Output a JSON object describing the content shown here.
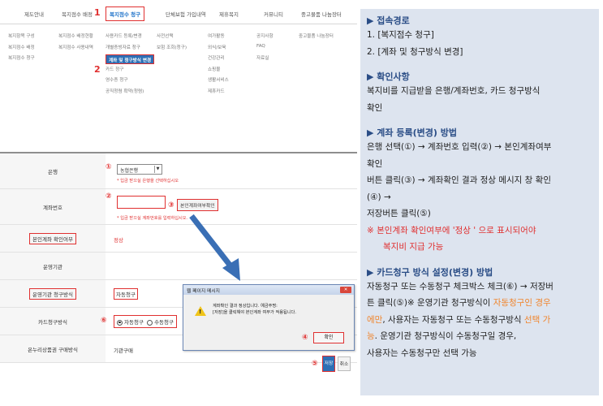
{
  "topnav": {
    "tabs": [
      "제도안내",
      "복지점수 배정",
      "복지점수 청구",
      "단체보험 가입내역",
      "제휴복지",
      "커뮤니티",
      "중고물품 나눔장터"
    ],
    "marker1": "1",
    "marker2": "2"
  },
  "submenu": {
    "col1": [
      "복지항목 구성",
      "복지점수 배정",
      "복지점수 청구"
    ],
    "col2": [
      "복지점수 배정현황",
      "복지점수 사용내역"
    ],
    "col3": [
      "사용카드 등록/변경",
      "개별증빙자료 청구",
      "계좌 및 청구방식 변경",
      "카드 청구",
      "영수증 청구",
      "공직청렴 확약(청렴)"
    ],
    "col4": [
      "사전선택",
      "보험 조회(청구)"
    ],
    "col5": [
      "여가활동",
      "외식/보육",
      "건강관리",
      "쇼핑몰",
      "생활서비스",
      "제휴카드"
    ],
    "col6": [
      "공지사항",
      "FAQ",
      "자료실"
    ],
    "col7": [
      "중고물품 나눔장터"
    ]
  },
  "form": {
    "bank_label": "은행",
    "bank_marker": "①",
    "bank_value": "농협은행",
    "bank_hint": "* 입금 받으실 은행을 선택하십시오",
    "account_label": "계좌번호",
    "account_marker": "②",
    "verify_marker": "③",
    "verify_button": "본인계좌여부확인",
    "account_hint": "* 입금 받으실 계좌번호를 입력하십시오.",
    "owner_check_label": "본인계좌 확인여부",
    "owner_check_value": "정상",
    "org_label": "운영기관",
    "org_method_label": "운영기관 청구방식",
    "org_method_value": "자동청구",
    "card_method_label": "카드청구방식",
    "card_marker": "⑥",
    "card_auto": "자동청구",
    "card_manual": "수동청구",
    "online_label": "온누리상품권 구매방식",
    "online_value": "기관구매",
    "save_marker": "⑤",
    "save_button": "저장",
    "cancel_button": "취소"
  },
  "dialog": {
    "title": "웹 페이지 메시지",
    "close": "✕",
    "message_line1": "계좌확인 결과 정상입니다. 예금주명:",
    "message_line2": "[저장]을 클릭해야 본인계좌 여부가 적용됩니다.",
    "ok_marker": "④",
    "ok_button": "확인"
  },
  "panel": {
    "s1_title": "▶ 접속경로",
    "s1_line1": "1. [복지점수 청구]",
    "s1_line2": "2. [계좌 및 청구방식 변경]",
    "s2_title": "▶ 확인사항",
    "s2_line1": "복지비를 지급받을 은행/계좌번호, 카드 청구방식",
    "s2_line2": "확인",
    "s3_title": "▶ 계좌 등록(변경) 방법",
    "s3_line1": "은행 선택(①) → 계좌번호 입력(②) → 본인계좌여부",
    "s3_line2": "확인",
    "s3_line3": "버튼 클릭(③) → 계좌확인 결과 정상 메시지 창 확인",
    "s3_line4": "(④) →",
    "s3_line5": "저장버튼 클릭(⑤)",
    "s3_note1": "※ 본인계좌 확인여부에 '정상 ' 으로 표시되어야",
    "s3_note2": "복지비 지급 가능",
    "s4_title": "▶ 카드청구 방식 설정(변경) 방법",
    "s4_line1": "자동청구 또는 수동청구 체크박스 체크(⑥) → 저장버",
    "s4_line2a": "튼 클릭(⑤)※ 운영기관 청구방식이 ",
    "s4_line2b": "자동청구인 경우",
    "s4_line3a": "에만",
    "s4_line3b": ", 사용자는 자동청구 또는 수동청구방식 ",
    "s4_line3c": "선택 가",
    "s4_line4a": "능",
    "s4_line4b": ". 운영기관 청구방식이 수동청구일 경우,",
    "s4_line5": "사용자는 수동청구만 선택 가능"
  },
  "colors": {
    "accent": "#2d6fb5",
    "marker": "#e03030",
    "panel_bg": "#dde4ef",
    "highlight": "#f0852d"
  }
}
